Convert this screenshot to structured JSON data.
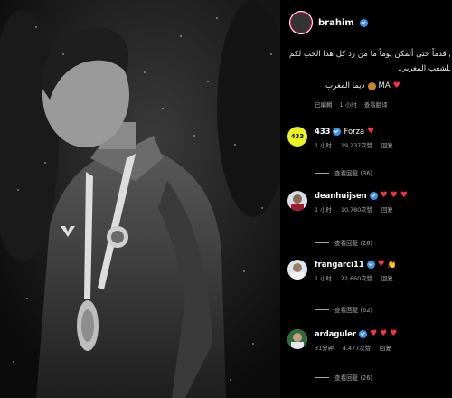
{
  "post": {
    "author": "brahim",
    "caption_line1": "ي قدماً حتى أتمكن يوماً ما من رد كل هذا الحب لكم",
    "caption_line2": ".وأن أكون فخراً للشعب المغربي",
    "caption_sign": "ديما المغرب",
    "caption_sign_suffix": "MA",
    "edited": "已編輯",
    "time": "1 小时",
    "see_translation": "查看翻译"
  },
  "comments": [
    {
      "user": "433",
      "text": "Forza",
      "hearts": 1,
      "time": "1 小时",
      "likes": "19,237次赞",
      "reply": "回复",
      "view_replies": "查看回复 (36)",
      "avatar_text": "433"
    },
    {
      "user": "deanhuijsen",
      "text": "",
      "hearts": 3,
      "time": "1 小时",
      "likes": "10,780次赞",
      "reply": "回复",
      "view_replies": "查看回复 (26)",
      "avatar_text": ""
    },
    {
      "user": "frangarci11",
      "text": "",
      "hearts": 2,
      "time": "1 小时",
      "likes": "22,660次赞",
      "reply": "回复",
      "view_replies": "查看回复 (62)",
      "avatar_text": ""
    },
    {
      "user": "ardaguler",
      "text": "",
      "hearts": 3,
      "time": "31分钟",
      "likes": "4,477次赞",
      "reply": "回复",
      "view_replies": "查看回复 (26)",
      "avatar_text": ""
    }
  ],
  "colors": {
    "heart": "#ff3040",
    "verified": "#3897f0",
    "muted": "#a8a8a8"
  },
  "icons": [
    "verified-badge-icon",
    "heart-icon",
    "lion-emoji-icon",
    "clap-emoji-icon"
  ]
}
